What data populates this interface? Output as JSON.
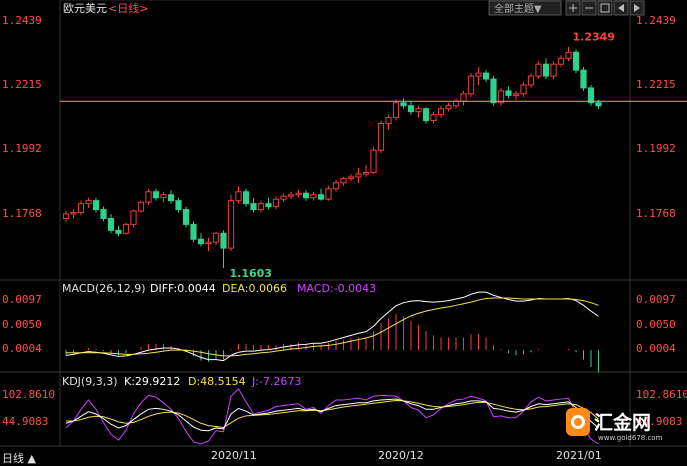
{
  "header": {
    "title": "欧元美元",
    "period_label": "<日线>",
    "theme_button": "全部主题▼",
    "icons": [
      "plus-icon",
      "minus-icon",
      "grid-icon",
      "left-icon",
      "right-icon"
    ]
  },
  "main": {
    "price_ticks": [
      "1.2439",
      "1.2215",
      "1.1992",
      "1.1768"
    ],
    "high_label": "1.2349",
    "low_label": "1.1603"
  },
  "macd": {
    "label": "MACD(26,12,9)",
    "diff": "DIFF:0.0044",
    "dea": "DEA:0.0066",
    "macd_val": "MACD:-0.0043",
    "ticks": [
      "0.0097",
      "0.0050",
      "0.0004"
    ]
  },
  "kdj": {
    "label": "KDJ(9,3,3)",
    "k": "K:29.9212",
    "d": "D:48.5154",
    "j": "J:-7.2673",
    "ticks": [
      "102.8610",
      "44.9083"
    ]
  },
  "xaxis": {
    "labels": [
      "2020/11",
      "2020/12",
      "2021/01"
    ]
  },
  "footer": {
    "period": "日线 ▲"
  },
  "watermark": {
    "brand": "汇金网",
    "site": "www.gold678.com"
  },
  "colors": {
    "up": "#f03c3c",
    "down": "#2fd18c",
    "price_text": "#ff4c4c",
    "diff_line": "#ffffff",
    "dea_line": "#f5e04a",
    "k_line": "#ffffff",
    "d_line": "#f5e04a",
    "j_line": "#d040ff",
    "current_price": "#ffa500",
    "low_label": "#3dd68c",
    "high_label": "#ff4040"
  },
  "chart_data": {
    "type": "candlestick",
    "y_range": [
      1.1603,
      1.2439
    ],
    "candles": [
      [
        1.177,
        1.1795,
        1.1758,
        1.1785
      ],
      [
        1.1785,
        1.18,
        1.177,
        1.179
      ],
      [
        1.179,
        1.183,
        1.178,
        1.182
      ],
      [
        1.182,
        1.184,
        1.1805,
        1.183
      ],
      [
        1.183,
        1.184,
        1.179,
        1.18
      ],
      [
        1.18,
        1.181,
        1.176,
        1.177
      ],
      [
        1.177,
        1.1785,
        1.172,
        1.173
      ],
      [
        1.173,
        1.1745,
        1.171,
        1.172
      ],
      [
        1.172,
        1.1755,
        1.1715,
        1.175
      ],
      [
        1.175,
        1.18,
        1.174,
        1.1795
      ],
      [
        1.1795,
        1.183,
        1.179,
        1.1825
      ],
      [
        1.1825,
        1.187,
        1.1815,
        1.186
      ],
      [
        1.186,
        1.187,
        1.183,
        1.184
      ],
      [
        1.184,
        1.186,
        1.1825,
        1.185
      ],
      [
        1.185,
        1.1865,
        1.182,
        1.183
      ],
      [
        1.183,
        1.184,
        1.179,
        1.18
      ],
      [
        1.18,
        1.181,
        1.174,
        1.175
      ],
      [
        1.175,
        1.176,
        1.169,
        1.17
      ],
      [
        1.17,
        1.172,
        1.1675,
        1.1685
      ],
      [
        1.1685,
        1.1705,
        1.166,
        1.169
      ],
      [
        1.169,
        1.1725,
        1.168,
        1.172
      ],
      [
        1.172,
        1.173,
        1.1603,
        1.167
      ],
      [
        1.167,
        1.185,
        1.166,
        1.183
      ],
      [
        1.183,
        1.188,
        1.182,
        1.186
      ],
      [
        1.186,
        1.187,
        1.181,
        1.182
      ],
      [
        1.182,
        1.184,
        1.179,
        1.18
      ],
      [
        1.18,
        1.183,
        1.179,
        1.182
      ],
      [
        1.182,
        1.184,
        1.18,
        1.181
      ],
      [
        1.181,
        1.1845,
        1.18,
        1.1835
      ],
      [
        1.1835,
        1.1855,
        1.1825,
        1.1845
      ],
      [
        1.1845,
        1.186,
        1.1835,
        1.185
      ],
      [
        1.185,
        1.1865,
        1.184,
        1.1855
      ],
      [
        1.1855,
        1.1865,
        1.183,
        1.184
      ],
      [
        1.184,
        1.186,
        1.183,
        1.185
      ],
      [
        1.185,
        1.187,
        1.183,
        1.1835
      ],
      [
        1.1835,
        1.188,
        1.183,
        1.187
      ],
      [
        1.187,
        1.19,
        1.186,
        1.189
      ],
      [
        1.189,
        1.191,
        1.188,
        1.1905
      ],
      [
        1.1905,
        1.192,
        1.1895,
        1.191
      ],
      [
        1.191,
        1.194,
        1.189,
        1.192
      ],
      [
        1.192,
        1.195,
        1.191,
        1.1925
      ],
      [
        1.1925,
        1.201,
        1.192,
        1.2
      ],
      [
        1.2,
        1.21,
        1.199,
        1.209
      ],
      [
        1.209,
        1.212,
        1.207,
        1.211
      ],
      [
        1.211,
        1.217,
        1.21,
        1.216
      ],
      [
        1.216,
        1.2175,
        1.214,
        1.215
      ],
      [
        1.215,
        1.2165,
        1.212,
        1.213
      ],
      [
        1.213,
        1.215,
        1.211,
        1.214
      ],
      [
        1.214,
        1.2145,
        1.209,
        1.21
      ],
      [
        1.21,
        1.213,
        1.209,
        1.212
      ],
      [
        1.212,
        1.215,
        1.211,
        1.214
      ],
      [
        1.214,
        1.216,
        1.213,
        1.215
      ],
      [
        1.215,
        1.2175,
        1.214,
        1.2165
      ],
      [
        1.2165,
        1.22,
        1.215,
        1.219
      ],
      [
        1.219,
        1.226,
        1.218,
        1.225
      ],
      [
        1.225,
        1.228,
        1.222,
        1.226
      ],
      [
        1.226,
        1.227,
        1.223,
        1.224
      ],
      [
        1.224,
        1.225,
        1.215,
        1.216
      ],
      [
        1.216,
        1.221,
        1.215,
        1.22
      ],
      [
        1.22,
        1.2215,
        1.2175,
        1.2185
      ],
      [
        1.2185,
        1.22,
        1.217,
        1.219
      ],
      [
        1.219,
        1.223,
        1.218,
        1.222
      ],
      [
        1.222,
        1.226,
        1.221,
        1.225
      ],
      [
        1.225,
        1.23,
        1.224,
        1.229
      ],
      [
        1.229,
        1.231,
        1.224,
        1.225
      ],
      [
        1.225,
        1.23,
        1.224,
        1.229
      ],
      [
        1.229,
        1.232,
        1.228,
        1.231
      ],
      [
        1.231,
        1.2349,
        1.23,
        1.233
      ],
      [
        1.233,
        1.234,
        1.226,
        1.227
      ],
      [
        1.227,
        1.228,
        1.22,
        1.221
      ],
      [
        1.221,
        1.222,
        1.215,
        1.216
      ],
      [
        1.216,
        1.217,
        1.214,
        1.215
      ]
    ],
    "current_price": 1.2165,
    "macd_range": [
      -0.003,
      0.012
    ],
    "diff": [
      -0.001,
      -0.0008,
      -0.0005,
      -0.0003,
      -0.0004,
      -0.0006,
      -0.0009,
      -0.0012,
      -0.0011,
      -0.0008,
      -0.0004,
      0.0,
      0.0002,
      0.0004,
      0.0004,
      0.0002,
      -0.0002,
      -0.0008,
      -0.0014,
      -0.0018,
      -0.0018,
      -0.002,
      -0.001,
      -0.0004,
      -0.0002,
      -0.0002,
      0.0,
      0.0001,
      0.0003,
      0.0006,
      0.0008,
      0.001,
      0.0011,
      0.0013,
      0.0013,
      0.0016,
      0.002,
      0.0024,
      0.0028,
      0.0032,
      0.0035,
      0.0045,
      0.006,
      0.0072,
      0.0084,
      0.009,
      0.0093,
      0.0094,
      0.0092,
      0.0091,
      0.0092,
      0.0094,
      0.0097,
      0.01,
      0.0106,
      0.011,
      0.011,
      0.0104,
      0.01,
      0.0096,
      0.0093,
      0.0093,
      0.0095,
      0.0098,
      0.0097,
      0.0097,
      0.0097,
      0.0098,
      0.0094,
      0.0085,
      0.0074,
      0.0064
    ],
    "dea": [
      -0.0005,
      -0.0005,
      -0.0005,
      -0.0005,
      -0.0005,
      -0.0005,
      -0.0006,
      -0.0007,
      -0.0008,
      -0.0008,
      -0.0007,
      -0.0006,
      -0.0004,
      -0.0002,
      0.0,
      0.0,
      0.0,
      -0.0002,
      -0.0004,
      -0.0007,
      -0.0009,
      -0.0011,
      -0.0011,
      -0.001,
      -0.0008,
      -0.0007,
      -0.0005,
      -0.0004,
      -0.0002,
      0.0,
      0.0002,
      0.0003,
      0.0005,
      0.0007,
      0.0008,
      0.0009,
      0.0011,
      0.0014,
      0.0017,
      0.002,
      0.0023,
      0.0027,
      0.0034,
      0.0042,
      0.005,
      0.0058,
      0.0065,
      0.007,
      0.0074,
      0.0077,
      0.008,
      0.0082,
      0.0085,
      0.0088,
      0.0091,
      0.0095,
      0.0098,
      0.0099,
      0.0099,
      0.0099,
      0.0098,
      0.0097,
      0.0097,
      0.0097,
      0.0097,
      0.0097,
      0.0097,
      0.0097,
      0.0096,
      0.0094,
      0.009,
      0.0085
    ],
    "kdj_range": [
      -20,
      120
    ],
    "k": [
      40,
      45,
      55,
      65,
      60,
      50,
      38,
      30,
      35,
      48,
      60,
      70,
      72,
      70,
      66,
      58,
      45,
      32,
      25,
      24,
      30,
      28,
      60,
      72,
      66,
      58,
      60,
      62,
      66,
      68,
      70,
      72,
      68,
      70,
      65,
      72,
      78,
      80,
      82,
      84,
      84,
      88,
      90,
      91,
      92,
      88,
      82,
      78,
      70,
      70,
      74,
      78,
      82,
      84,
      88,
      88,
      86,
      72,
      70,
      66,
      64,
      68,
      76,
      82,
      80,
      82,
      84,
      86,
      74,
      58,
      44,
      30
    ],
    "d": [
      45,
      45,
      48,
      53,
      55,
      54,
      49,
      43,
      40,
      42,
      48,
      55,
      60,
      63,
      64,
      62,
      56,
      48,
      40,
      35,
      33,
      31,
      41,
      51,
      56,
      57,
      58,
      59,
      61,
      63,
      65,
      67,
      67,
      68,
      67,
      69,
      72,
      75,
      77,
      79,
      81,
      83,
      85,
      87,
      89,
      88,
      86,
      83,
      79,
      76,
      75,
      76,
      78,
      80,
      83,
      85,
      85,
      81,
      77,
      73,
      70,
      69,
      71,
      75,
      76,
      78,
      80,
      82,
      80,
      72,
      63,
      49
    ],
    "j": [
      30,
      45,
      70,
      90,
      70,
      42,
      16,
      4,
      25,
      60,
      84,
      100,
      96,
      84,
      70,
      50,
      23,
      0,
      -5,
      2,
      24,
      22,
      98,
      114,
      86,
      60,
      64,
      68,
      76,
      78,
      80,
      82,
      70,
      74,
      61,
      78,
      90,
      90,
      92,
      94,
      90,
      98,
      100,
      99,
      98,
      88,
      74,
      68,
      52,
      58,
      72,
      82,
      90,
      92,
      98,
      94,
      88,
      54,
      56,
      52,
      52,
      66,
      86,
      96,
      88,
      90,
      92,
      94,
      62,
      30,
      6,
      -7
    ]
  }
}
